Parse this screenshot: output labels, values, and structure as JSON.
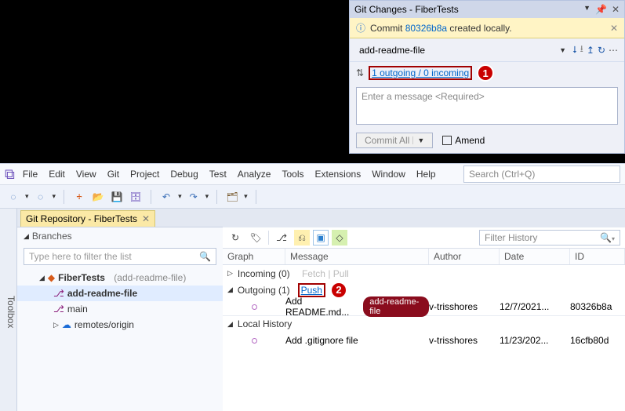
{
  "git_changes": {
    "title": "Git Changes - FiberTests",
    "notice_pre": "Commit ",
    "notice_commit": "80326b8a",
    "notice_post": " created locally.",
    "branch": "add-readme-file",
    "sync_link": "1 outgoing / 0 incoming",
    "msg_placeholder": "Enter a message <Required>",
    "commit_all": "Commit All",
    "amend": "Amend",
    "marker1": "1"
  },
  "menu": {
    "file": "File",
    "edit": "Edit",
    "view": "View",
    "git": "Git",
    "project": "Project",
    "debug": "Debug",
    "test": "Test",
    "analyze": "Analyze",
    "tools": "Tools",
    "extensions": "Extensions",
    "window": "Window",
    "help": "Help",
    "search_placeholder": "Search (Ctrl+Q)"
  },
  "toolbox": "Toolbox",
  "tab": {
    "title": "Git Repository - FiberTests"
  },
  "branches": {
    "header": "Branches",
    "filter_placeholder": "Type here to filter the list",
    "repo": "FiberTests",
    "repo_branch": "(add-readme-file)",
    "items": [
      "add-readme-file",
      "main",
      "remotes/origin"
    ]
  },
  "history": {
    "filter_placeholder": "Filter History",
    "cols": {
      "graph": "Graph",
      "message": "Message",
      "author": "Author",
      "date": "Date",
      "id": "ID"
    },
    "incoming_label": "Incoming (0)",
    "incoming_fetch": "Fetch",
    "incoming_pull": "Pull",
    "outgoing_label": "Outgoing (1)",
    "outgoing_push": "Push",
    "marker2": "2",
    "commit1": {
      "msg": "Add README.md...",
      "pill": "add-readme-file",
      "author": "v-trisshores",
      "date": "12/7/2021...",
      "id": "80326b8a"
    },
    "local_label": "Local History",
    "commit2": {
      "msg": "Add .gitignore file",
      "author": "v-trisshores",
      "date": "11/23/202...",
      "id": "16cfb80d"
    }
  }
}
